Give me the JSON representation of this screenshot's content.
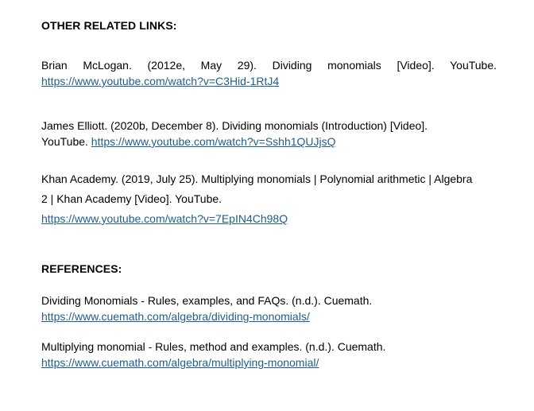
{
  "sections": {
    "related_heading": "OTHER RELATED LINKS:",
    "references_heading": "REFERENCES:"
  },
  "related": [
    {
      "line1_words": [
        "Brian",
        "McLogan.",
        "(2012e,",
        "May",
        "29).",
        "Dividing",
        "monomials",
        "[Video].",
        "YouTube."
      ],
      "url": "https://www.youtube.com/watch?v=C3Hid-1RtJ4"
    },
    {
      "line1": "James Elliott. (2020b, December 8). Dividing monomials (Introduction) [Video].",
      "line2_prefix": "YouTube. ",
      "url": "https://www.youtube.com/watch?v=Sshh1QUJjsQ"
    },
    {
      "line1": "Khan Academy. (2019, July 25). Multiplying monomials | Polynomial arithmetic | Algebra",
      "line2": "2 | Khan Academy [Video]. YouTube.",
      "url": "https://www.youtube.com/watch?v=7EpIN4Ch98Q"
    }
  ],
  "references": [
    {
      "line1": "Dividing Monomials - Rules, examples, and FAQs. (n.d.). Cuemath.",
      "url": "https://www.cuemath.com/algebra/dividing-monomials/"
    },
    {
      "line1": "Multiplying monomial - Rules, method and examples. (n.d.). Cuemath.",
      "url": "https://www.cuemath.com/algebra/multiplying-monomial/"
    }
  ],
  "colors": {
    "text": "#000000",
    "link": "#1f5e8c",
    "background": "#ffffff"
  }
}
